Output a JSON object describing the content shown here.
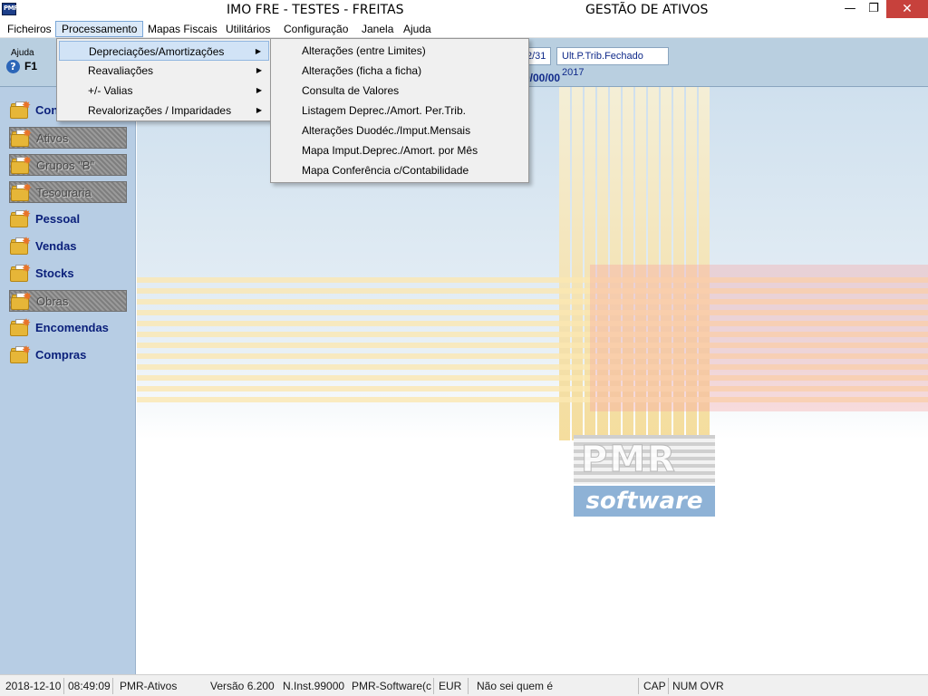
{
  "window": {
    "app_icon_text": "PMR",
    "title_left": "IMO FRE - TESTES - FREITAS",
    "title_right": "GESTÃO DE ATIVOS",
    "minimize": "—",
    "restore": "❐",
    "close": "✕"
  },
  "menubar": {
    "items": [
      "Ficheiros",
      "Processamento",
      "Mapas Fiscais",
      "Utilitários",
      "Configuração",
      "Janela",
      "Ajuda"
    ]
  },
  "toolbar": {
    "help_label": "Ajuda",
    "help_icon": "?",
    "help_key": "F1",
    "date_box": "2/31",
    "period_box": "Ult.P.Trib.Fechado 2017",
    "date_text": "0/00/00"
  },
  "sidebar": {
    "items": [
      {
        "label": "Con",
        "icon": "folder-star-icon",
        "disabled": false
      },
      {
        "label": "Ativos",
        "icon": "folder-star-icon",
        "disabled": true
      },
      {
        "label": "Grupos \"B\"",
        "icon": "folder-star-icon",
        "disabled": true
      },
      {
        "label": "Tesouraria",
        "icon": "folder-star-icon",
        "disabled": true
      },
      {
        "label": "Pessoal",
        "icon": "folder-star-icon",
        "disabled": false
      },
      {
        "label": "Vendas",
        "icon": "folder-star-icon",
        "disabled": false
      },
      {
        "label": "Stocks",
        "icon": "folder-star-icon",
        "disabled": false
      },
      {
        "label": "Obras",
        "icon": "folder-star-icon",
        "disabled": true
      },
      {
        "label": "Encomendas",
        "icon": "folder-star-icon",
        "disabled": false
      },
      {
        "label": "Compras",
        "icon": "folder-star-icon",
        "disabled": false
      }
    ]
  },
  "processamento_menu": {
    "items": [
      {
        "label": "Depreciações/Amortizações",
        "submenu": true,
        "highlighted": true
      },
      {
        "label": "Reavaliações",
        "submenu": true
      },
      {
        "label": "+/- Valias",
        "submenu": true
      },
      {
        "label": "Revalorizações / Imparidades",
        "submenu": true
      }
    ],
    "arrow_glyph": "▶"
  },
  "depreciacoes_submenu": {
    "items": [
      "Alterações  (entre Limites)",
      "Alterações (ficha a ficha)",
      "Consulta de Valores",
      "Listagem Deprec./Amort. Per.Trib.",
      "Alterações Duodéc./Imput.Mensais",
      "Mapa Imput.Deprec./Amort. por Mês",
      "Mapa  Conferência c/Contabilidade"
    ]
  },
  "logo": {
    "wordmark": "PMR",
    "tagline": "software"
  },
  "statusbar": {
    "date": "2018-12-10",
    "time": "08:49:09",
    "module": "PMR-Ativos",
    "version": "Versão  6.200",
    "install": "N.Inst.99000",
    "company": "PMR-Software(c)",
    "currency": "EUR",
    "user": "Não sei quem é",
    "cap": "CAP",
    "num_ovr": "NUM OVR"
  },
  "colors": {
    "sidebar_bg": "#b7cde4",
    "label_blue": "#0a1f7a",
    "menu_highlight": "#d1e3f6",
    "close_red": "#c7413c"
  }
}
